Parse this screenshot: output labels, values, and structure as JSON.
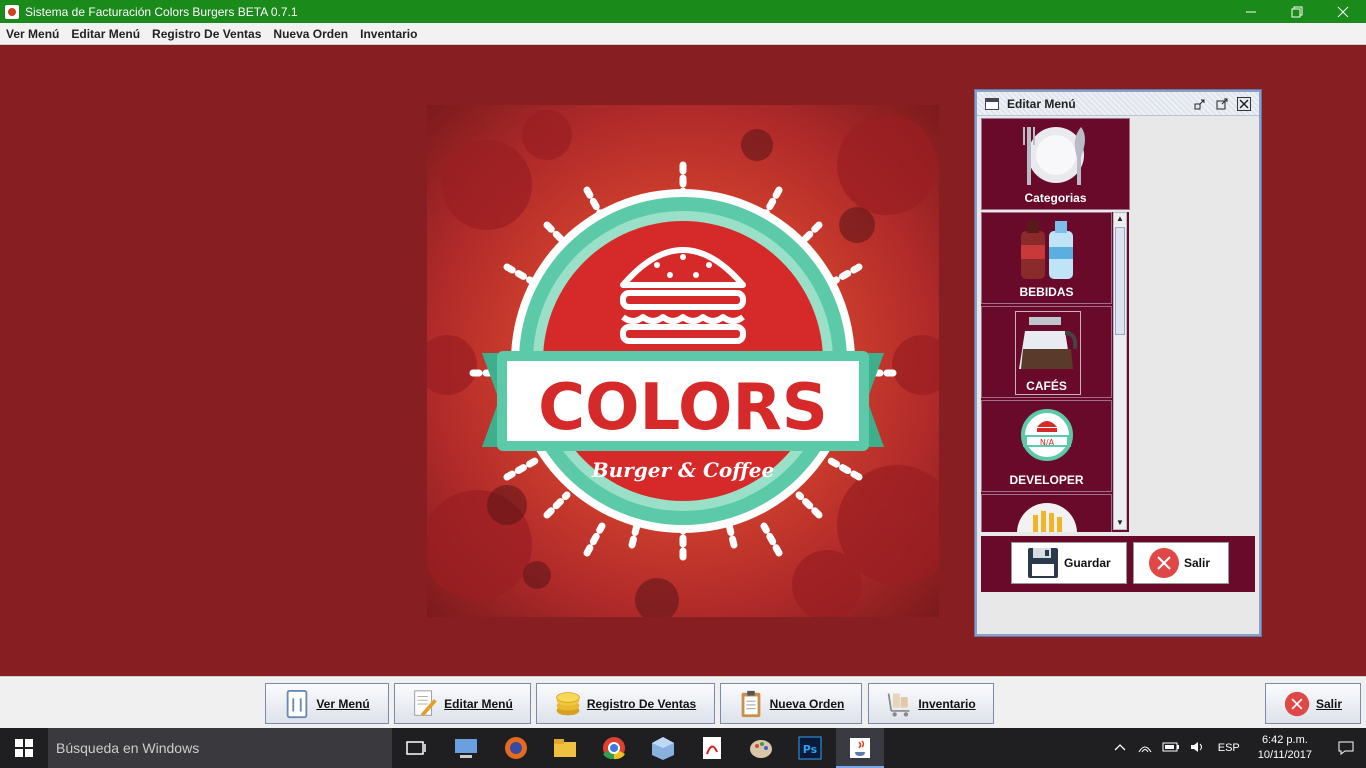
{
  "window": {
    "title": "Sistema de Facturación Colors Burgers BETA 0.7.1",
    "controls": [
      "minimize",
      "restore",
      "close"
    ]
  },
  "menubar": {
    "items": [
      "Ver Menú",
      "Editar Menú",
      "Registro De Ventas",
      "Nueva Orden",
      "Inventario"
    ]
  },
  "logo": {
    "brand": "COLORS",
    "tagline": "Burger & Coffee"
  },
  "editor": {
    "title": "Editar Menú",
    "categories_label": "Categorias",
    "items": [
      {
        "label": "BEBIDAS",
        "icon": "soda-bottles-icon"
      },
      {
        "label": "CAFÉS",
        "icon": "coffee-pot-icon"
      },
      {
        "label": "DEVELOPER",
        "icon": "burger-badge-icon"
      },
      {
        "label": "",
        "icon": "fries-icon"
      }
    ],
    "save_label": "Guardar",
    "exit_label": "Salir"
  },
  "toolbar": {
    "buttons": [
      {
        "label": "Ver Menú",
        "icon": "menu-card-icon"
      },
      {
        "label": "Editar Menú",
        "icon": "edit-document-icon"
      },
      {
        "label": "Registro De Ventas",
        "icon": "coins-icon"
      },
      {
        "label": "Nueva Orden",
        "icon": "clipboard-icon"
      },
      {
        "label": "Inventario",
        "icon": "inventory-cart-icon"
      }
    ],
    "exit_label": "Salir"
  },
  "taskbar": {
    "search_placeholder": "Búsqueda en Windows",
    "language": "ESP",
    "time": "6:42 p.m.",
    "date": "10/11/2017"
  },
  "colors": {
    "titlebar": "#1a8a1a",
    "desktop": "#871e21",
    "tile": "#6a0a2a",
    "accent_teal": "#5cc9a8",
    "exit_red": "#e04848"
  }
}
